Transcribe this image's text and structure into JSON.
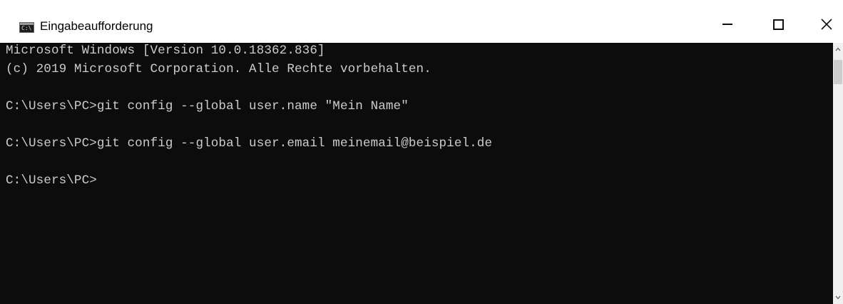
{
  "window": {
    "title": "Eingabeaufforderung",
    "icon": "cmd-icon",
    "controls": {
      "minimize": "minimize-icon",
      "maximize": "maximize-icon",
      "close": "close-icon"
    }
  },
  "console": {
    "lines": [
      "Microsoft Windows [Version 10.0.18362.836]",
      "(c) 2019 Microsoft Corporation. Alle Rechte vorbehalten.",
      "C:\\Users\\PC>git config --global user.name \"Mein Name\"",
      "C:\\Users\\PC>git config --global user.email meinemail@beispiel.de",
      "C:\\Users\\PC>"
    ],
    "colors": {
      "background": "#0c0c0c",
      "text": "#cccccc"
    }
  }
}
